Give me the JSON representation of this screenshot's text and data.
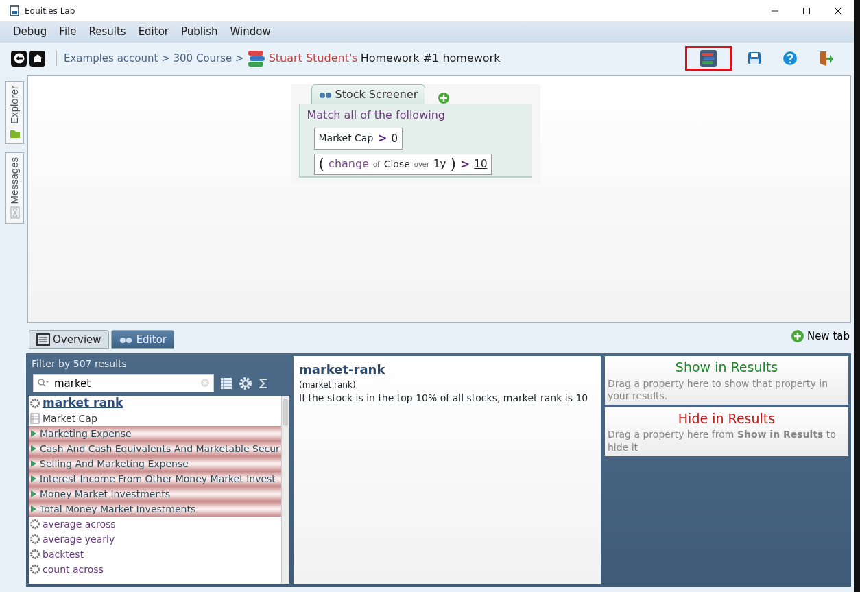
{
  "window": {
    "title": "Equities Lab"
  },
  "menu": [
    "Debug",
    "File",
    "Results",
    "Editor",
    "Publish",
    "Window"
  ],
  "breadcrumb": {
    "path": "Examples account > 300 Course >",
    "owner": "Stuart Student's",
    "title": "Homework #1 homework"
  },
  "toolbar": [
    {
      "kind": "books",
      "selected": true
    },
    {
      "kind": "save",
      "selected": false
    },
    {
      "kind": "help",
      "selected": false
    },
    {
      "kind": "exit",
      "selected": false
    }
  ],
  "side_tabs": [
    {
      "label": "Explorer",
      "kind": "explorer"
    },
    {
      "label": "Messages",
      "kind": "messages"
    }
  ],
  "screener": {
    "tab": "Stock Screener",
    "heading": "Match all of the following",
    "conditions": [
      [
        {
          "kind": "field",
          "text": "Market Cap"
        },
        {
          "kind": "op",
          "text": ">"
        },
        {
          "kind": "value",
          "text": "0"
        }
      ],
      [
        {
          "kind": "paren",
          "text": "("
        },
        {
          "kind": "func",
          "text": "change"
        },
        {
          "kind": "small",
          "text": "of"
        },
        {
          "kind": "field",
          "text": "Close"
        },
        {
          "kind": "small",
          "text": "over"
        },
        {
          "kind": "value",
          "text": "1y"
        },
        {
          "kind": "paren",
          "text": ")"
        },
        {
          "kind": "op",
          "text": ">"
        },
        {
          "kind": "link",
          "text": "10"
        }
      ]
    ]
  },
  "view_tabs": [
    {
      "label": "Overview",
      "kind": "overview",
      "selected": false
    },
    {
      "label": "Editor",
      "kind": "editor",
      "selected": true
    }
  ],
  "new_tab": "New tab",
  "filter": {
    "label": "Filter by 507 results",
    "search": "market",
    "items": [
      {
        "text": "market rank",
        "kind": "function",
        "selected": true
      },
      {
        "text": "Market Cap",
        "kind": "table",
        "selected": false
      },
      {
        "text": "Marketing Expense",
        "kind": "field",
        "selected": false
      },
      {
        "text": "Cash And Cash Equivalents And Marketable Secur",
        "kind": "field",
        "selected": false
      },
      {
        "text": "Selling And Marketing Expense",
        "kind": "field",
        "selected": false
      },
      {
        "text": "Interest Income From Other Money Market Invest",
        "kind": "field",
        "selected": false
      },
      {
        "text": "Money Market Investments",
        "kind": "field",
        "selected": false
      },
      {
        "text": "Total Money Market Investments",
        "kind": "field",
        "selected": false
      },
      {
        "text": "average across",
        "kind": "function",
        "selected": false
      },
      {
        "text": "average yearly",
        "kind": "function",
        "selected": false
      },
      {
        "text": "backtest",
        "kind": "function",
        "selected": false
      },
      {
        "text": "count across",
        "kind": "function",
        "selected": false
      }
    ]
  },
  "detail": {
    "title": "market-rank",
    "subtitle": "(market rank)",
    "description": "If the stock is in the top 10% of all stocks, market rank is 10"
  },
  "drop_zones": [
    {
      "kind": "show",
      "title": "Show in Results",
      "text": "Drag a property here to show that property in your results."
    },
    {
      "kind": "hide",
      "title": "Hide in Results",
      "text": "Drag a property here from **Show in Results** to hide it"
    }
  ]
}
